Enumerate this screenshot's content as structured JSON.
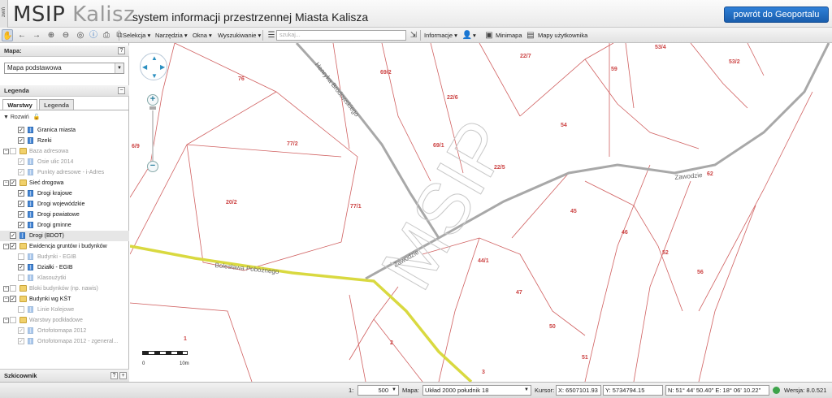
{
  "header": {
    "collapse_label": "zwiń",
    "logo_main": "MSIP",
    "logo_city": "Kalisz",
    "subtitle": "system informacji przestrzennej Miasta Kalisza",
    "portal_button": "powrót do Geoportalu"
  },
  "toolbar": {
    "icons": [
      "pan-hand",
      "back-arrow",
      "forward-arrow",
      "zoom-in",
      "zoom-out",
      "zoom-extent",
      "info",
      "print",
      "zoom-window"
    ],
    "menus": [
      "Selekcja",
      "Narzędzia",
      "Okna",
      "Wyszukiwanie"
    ],
    "search_placeholder": "szukaj...",
    "info_menu": "Informacje",
    "minimap": "Minimapa",
    "user_maps": "Mapy użytkownika"
  },
  "sidebar": {
    "map_title": "Mapa:",
    "map_selected": "Mapa podstawowa",
    "legend_title": "Legenda",
    "tabs": [
      "Warstwy",
      "Legenda"
    ],
    "expand_label": "Rozwiń",
    "layers": [
      {
        "label": "Granica miasta",
        "checked": true,
        "dim": false,
        "folder": false
      },
      {
        "label": "Rzeki",
        "checked": true,
        "dim": false,
        "folder": false
      },
      {
        "label": "Baza adresowa",
        "checked": false,
        "dim": true,
        "folder": true
      },
      {
        "label": "Osie ulic 2014",
        "checked": true,
        "dim": true,
        "folder": false
      },
      {
        "label": "Punkty adresowe - i-Adres",
        "checked": true,
        "dim": true,
        "folder": false
      },
      {
        "label": "Sieć drogowa",
        "checked": true,
        "dim": false,
        "folder": true
      },
      {
        "label": "Drogi krajowe",
        "checked": true,
        "dim": false,
        "folder": false
      },
      {
        "label": "Drogi wojewódzkie",
        "checked": true,
        "dim": false,
        "folder": false
      },
      {
        "label": "Drogi powiatowe",
        "checked": true,
        "dim": false,
        "folder": false
      },
      {
        "label": "Drogi gminne",
        "checked": true,
        "dim": false,
        "folder": false
      },
      {
        "label": "Drogi (BDOT)",
        "checked": true,
        "dim": false,
        "folder": false
      },
      {
        "label": "Ewidencja gruntów i budynków",
        "checked": true,
        "dim": false,
        "folder": true
      },
      {
        "label": "Budynki - EGIB",
        "checked": false,
        "dim": true,
        "folder": false
      },
      {
        "label": "Działki - EGIB",
        "checked": true,
        "dim": false,
        "folder": false
      },
      {
        "label": "Klasoużytki",
        "checked": false,
        "dim": true,
        "folder": false
      },
      {
        "label": "Bloki budynków (np. nawis)",
        "checked": false,
        "dim": true,
        "folder": true
      },
      {
        "label": "Budynki wg KŚT",
        "checked": true,
        "dim": false,
        "folder": true
      },
      {
        "label": "Linie Kolejowe",
        "checked": false,
        "dim": true,
        "folder": false
      },
      {
        "label": "Warstwy podkładowe",
        "checked": false,
        "dim": true,
        "folder": true
      },
      {
        "label": "Ortofotomapa 2012",
        "checked": true,
        "dim": true,
        "folder": false
      },
      {
        "label": "Ortofotomapa 2012 - zgeneral...",
        "checked": true,
        "dim": true,
        "folder": false
      }
    ],
    "sketch_title": "Szkicownik"
  },
  "map": {
    "watermark": "MSIP",
    "plots": [
      "76",
      "69/2",
      "22/7",
      "59",
      "53/4",
      "53/2",
      "22/6",
      "54",
      "77/2",
      "69/1",
      "6/9",
      "22/5",
      "62",
      "20/2",
      "77/1",
      "45",
      "46",
      "52",
      "44/1",
      "56",
      "47",
      "50",
      "1",
      "2",
      "51",
      "3"
    ],
    "streets": [
      "Henryka Brodowskiego",
      "Zawodzie",
      "Zawodzie",
      "Bolesława Pobożnego"
    ],
    "scale_start": "0",
    "scale_end": "10m"
  },
  "statusbar": {
    "scale_prefix": "1:",
    "scale_value": "500",
    "map_label": "Mapa:",
    "crs_value": "Układ 2000 południk 18",
    "cursor_label": "Kursor:",
    "coord_x": "X: 6507101.93",
    "coord_y": "Y: 5734794.15",
    "coord_geo": "N: 51° 44' 50.40\" E: 18° 06' 10.22\"",
    "version": "Wersja: 8.0.521"
  }
}
